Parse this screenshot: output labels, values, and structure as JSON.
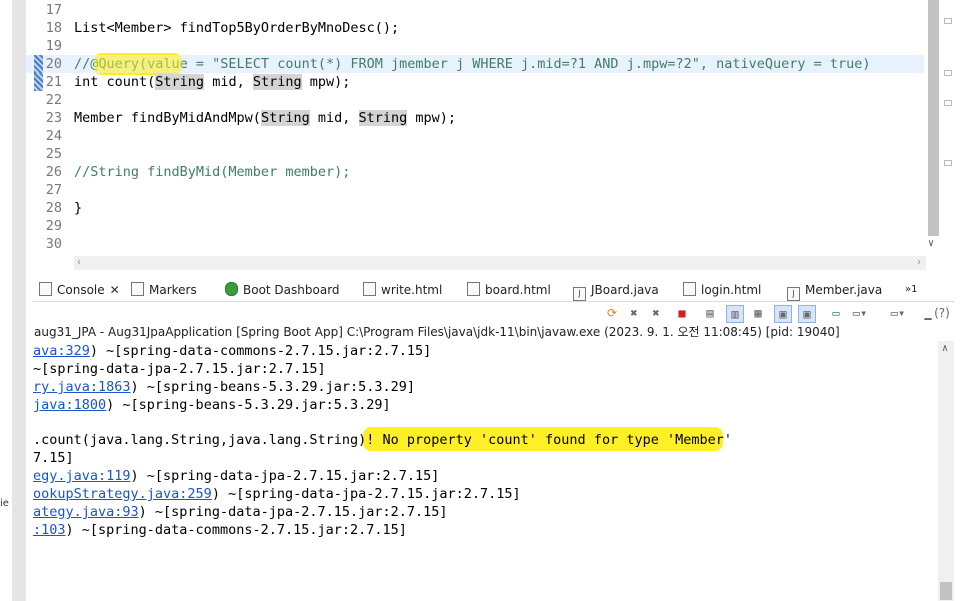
{
  "editor": {
    "lines": [
      {
        "num": "17",
        "text": ""
      },
      {
        "num": "18",
        "text": "List<Member> findTop5ByOrderByMnoDesc();"
      },
      {
        "num": "19",
        "text": ""
      },
      {
        "num": "20",
        "text": "//@Query(value = \"SELECT count(*) FROM jmember j WHERE j.mid=?1 AND j.mpw=?2\", nativeQuery = true)"
      },
      {
        "num": "21",
        "pre": "int count(",
        "kw1": "String",
        "mid": " mid, ",
        "kw2": "String",
        "post": " mpw);"
      },
      {
        "num": "22",
        "text": ""
      },
      {
        "num": "23",
        "pre": "Member findByMidAndMpw(",
        "kw1": "String",
        "mid": " mid, ",
        "kw2": "String",
        "post": " mpw);"
      },
      {
        "num": "24",
        "text": ""
      },
      {
        "num": "25",
        "text": ""
      },
      {
        "num": "26",
        "text": "//String findByMid(Member member);"
      },
      {
        "num": "27",
        "text": ""
      },
      {
        "num": "28",
        "text": "}"
      },
      {
        "num": "29",
        "text": ""
      },
      {
        "num": "30",
        "text": ""
      }
    ]
  },
  "tabs": [
    {
      "label": "Console",
      "icon": "console-icon",
      "active": true
    },
    {
      "label": "Markers",
      "icon": "markers-icon"
    },
    {
      "label": "Boot Dashboard",
      "icon": "boot-dashboard-icon"
    },
    {
      "label": "write.html",
      "icon": "html-file-icon"
    },
    {
      "label": "board.html",
      "icon": "html-file-icon"
    },
    {
      "label": "JBoard.java",
      "icon": "java-file-icon"
    },
    {
      "label": "login.html",
      "icon": "html-file-icon"
    },
    {
      "label": "Member.java",
      "icon": "java-file-icon"
    },
    {
      "label": "»1",
      "icon": ""
    }
  ],
  "console": {
    "launch_info": "aug31_JPA - Aug31JpaApplication [Spring Boot App] C:\\Program Files\\java\\jdk-11\\bin\\javaw.exe  (2023. 9. 1. 오전 11:08:45) [pid: 19040]",
    "lines": [
      {
        "link": "ava:329",
        "text": ") ~[spring-data-commons-2.7.15.jar:2.7.15]"
      },
      {
        "link": "",
        "text": "~[spring-data-jpa-2.7.15.jar:2.7.15]"
      },
      {
        "link": "ry.java:1863",
        "text": ") ~[spring-beans-5.3.29.jar:5.3.29]"
      },
      {
        "link": "java:1800",
        "text": ") ~[spring-beans-5.3.29.jar:5.3.29]"
      },
      {
        "link": "",
        "text": ""
      },
      {
        "link": "",
        "text": ".count(java.lang.String,java.lang.String)! No property 'count' found for type 'Member'"
      },
      {
        "link": "",
        "text": "7.15]"
      },
      {
        "link": "egy.java:119",
        "text": ") ~[spring-data-jpa-2.7.15.jar:2.7.15]"
      },
      {
        "link": "ookupStrategy.java:259",
        "text": ") ~[spring-data-jpa-2.7.15.jar:2.7.15]"
      },
      {
        "link": "ategy.java:93",
        "text": ") ~[spring-data-jpa-2.7.15.jar:2.7.15]"
      },
      {
        "link": ":103",
        "text": ") ~[spring-data-commons-2.7.15.jar:2.7.15]"
      }
    ]
  },
  "toolbar": {
    "help_label": "(?)"
  },
  "left_strip": {
    "text": "ie"
  },
  "colors": {
    "highlight": "#ffee1a",
    "comment": "#3f7f5f",
    "link": "#1a55c9"
  }
}
